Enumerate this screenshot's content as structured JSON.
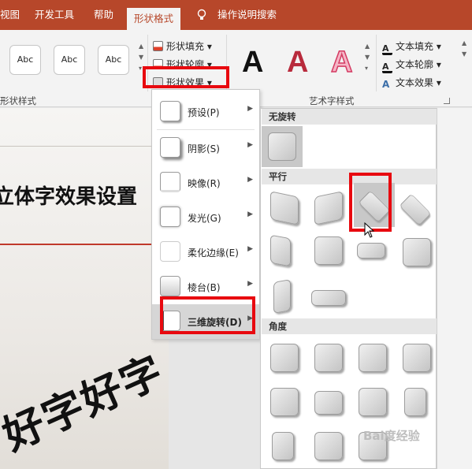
{
  "tabs": [
    "视图",
    "开发工具",
    "帮助",
    "形状格式"
  ],
  "active_tab": "形状格式",
  "tell_me": "操作说明搜索",
  "shape_styles": {
    "thumbs": [
      "Abc",
      "Abc",
      "Abc"
    ],
    "group_label": "形状样式",
    "fill": "形状填充",
    "outline": "形状轮廓",
    "effects": "形状效果"
  },
  "wordart": {
    "letters": [
      "A",
      "A",
      "A"
    ],
    "group_label": "艺术字样式",
    "text_fill": "文本填充",
    "text_outline": "文本轮廓",
    "text_effects": "文本效果"
  },
  "slide": {
    "title": "立体字效果设置",
    "big_text": "好字好字"
  },
  "menu": [
    {
      "label": "预设(P)"
    },
    {
      "label": "阴影(S)"
    },
    {
      "label": "映像(R)"
    },
    {
      "label": "发光(G)"
    },
    {
      "label": "柔化边缘(E)"
    },
    {
      "label": "棱台(B)"
    },
    {
      "label": "三维旋转(D)"
    }
  ],
  "gallery": {
    "section_none": "无旋转",
    "section_parallel": "平行",
    "section_perspective": "角度"
  },
  "watermark": "Bai度经验",
  "colors": {
    "accent": "#b7472a",
    "highlight": "#e8090f"
  }
}
